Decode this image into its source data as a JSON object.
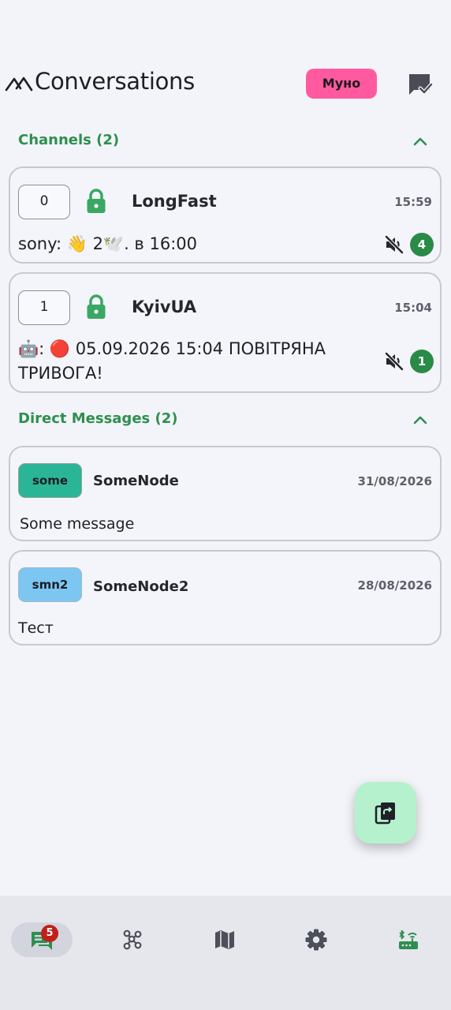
{
  "header": {
    "title": "Conversations",
    "node_chip": "Муно"
  },
  "channels_section": {
    "title": "Channels (2)"
  },
  "channels": [
    {
      "index": "0",
      "name": "LongFast",
      "time": "15:59",
      "message": "sony: 👋 2🕊️. в 16:00",
      "unread": "4"
    },
    {
      "index": "1",
      "name": "KyivUA",
      "time": "15:04",
      "message_line1": "🤖: 🔴 05.09.2026 15:04 ПОВІТРЯНА",
      "message_line2": "ТРИВОГА!",
      "unread": "1"
    }
  ],
  "dm_section": {
    "title": "Direct Messages (2)"
  },
  "direct_messages": [
    {
      "avatar": "some",
      "avatar_color": "#2bb597",
      "name": "SomeNode",
      "date": "31/08/2026",
      "message": "Some message"
    },
    {
      "avatar": "smn2",
      "avatar_color": "#7dc6f2",
      "name": "SomeNode2",
      "date": "28/08/2026",
      "message": "Тест"
    }
  ],
  "bottom_nav": {
    "conversations_badge": "5",
    "items": [
      "conversations-icon",
      "nodes-icon",
      "map-icon",
      "settings-icon",
      "connections-icon"
    ]
  },
  "colors": {
    "accent_green": "#2e8f4f",
    "node_chip": "#ff5aa0",
    "fab": "#b6f1cd",
    "badge_red": "#c0201b"
  }
}
